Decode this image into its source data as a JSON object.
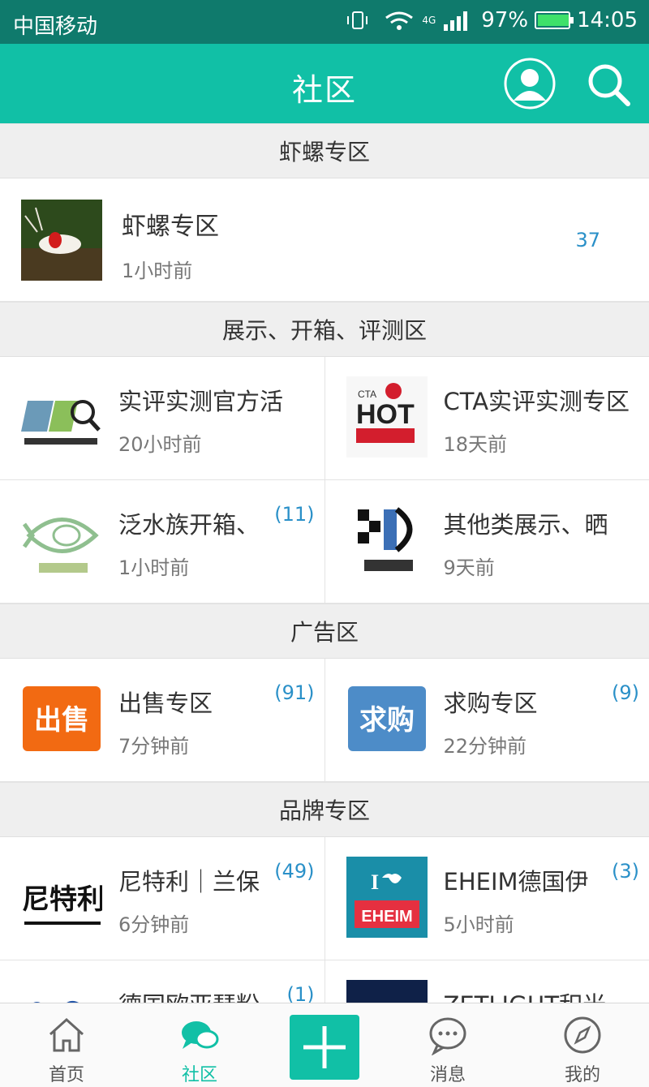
{
  "status_bar": {
    "carrier": "中国移动",
    "network": "4G",
    "battery": "97%",
    "battery_level": 0.97,
    "time": "14:05"
  },
  "header": {
    "title": "社区",
    "accent_color": "#11c0a6"
  },
  "sections": [
    {
      "title": "虾螺专区",
      "items": [
        {
          "name": "虾螺专区",
          "time": "1小时前",
          "count": "37",
          "icon": "shrimp-photo"
        }
      ]
    },
    {
      "title": "展示、开箱、评测区",
      "items": [
        {
          "name": "实评实测官方活",
          "time": "20小时前",
          "count": "",
          "icon": "cta-official-logo"
        },
        {
          "name": "CTA实评实测专区",
          "time": "18天前",
          "count": "",
          "icon": "hot-logo"
        },
        {
          "name": "泛水族开箱、",
          "time": "1小时前",
          "count": "(11)",
          "icon": "fanshuizu-logo"
        },
        {
          "name": "其他类展示、晒",
          "time": "9天前",
          "count": "",
          "icon": "other-logo"
        }
      ]
    },
    {
      "title": "广告区",
      "items": [
        {
          "name": "出售专区",
          "time": "7分钟前",
          "count": "(91)",
          "icon": "sell-logo",
          "icon_text": "出售"
        },
        {
          "name": "求购专区",
          "time": "22分钟前",
          "count": "(9)",
          "icon": "buy-logo",
          "icon_text": "求购"
        }
      ]
    },
    {
      "title": "品牌专区",
      "items": [
        {
          "name": "尼特利｜兰保",
          "time": "6分钟前",
          "count": "(49)",
          "icon": "nitely-logo",
          "icon_text": "尼特利"
        },
        {
          "name": "EHEIM德国伊",
          "time": "5小时前",
          "count": "(3)",
          "icon": "eheim-logo",
          "icon_text": "EHEIM"
        },
        {
          "name": "德国欧亚琵粉",
          "time": "",
          "count": "(1)",
          "icon": "brand-logo"
        },
        {
          "name": "ZETLIGHT积光",
          "time": "",
          "count": "",
          "icon": "zetlight-logo"
        }
      ]
    }
  ],
  "tabbar": {
    "home": "首页",
    "community": "社区",
    "messages": "消息",
    "mine": "我的"
  }
}
